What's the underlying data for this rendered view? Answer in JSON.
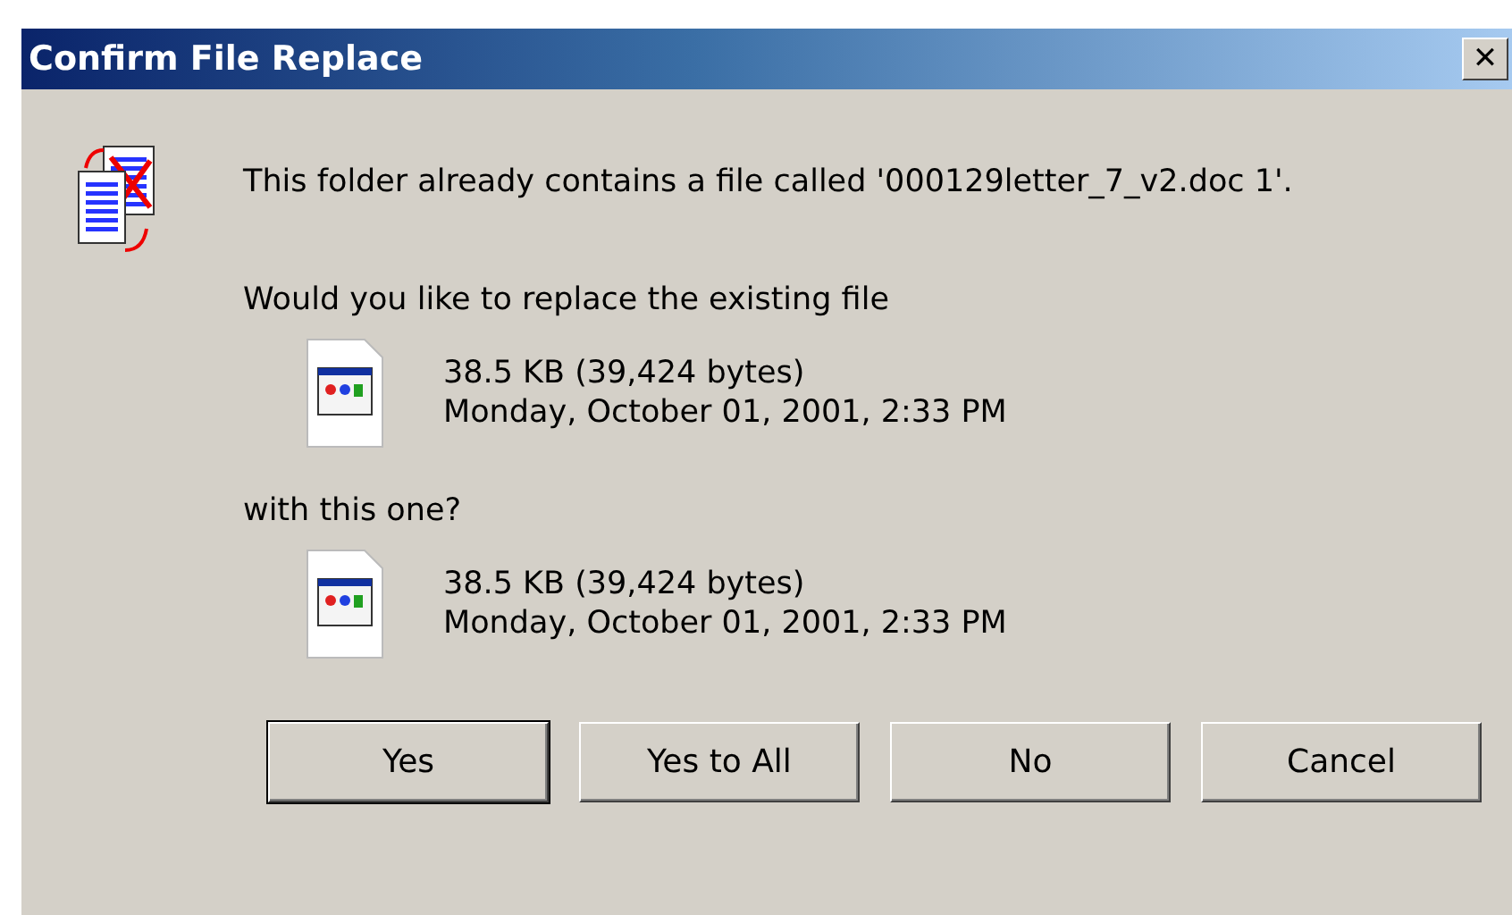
{
  "window": {
    "title": "Confirm File Replace",
    "close": "✕"
  },
  "message": "This folder already contains a file called '000129letter_7_v2.doc 1'.",
  "question": "Would you like to replace the existing file",
  "existing_file": {
    "size": "38.5 KB (39,424 bytes)",
    "modified": "Monday, October 01, 2001, 2:33 PM"
  },
  "connector": "with this one?",
  "new_file": {
    "size": "38.5 KB (39,424 bytes)",
    "modified": "Monday, October 01, 2001, 2:33 PM"
  },
  "buttons": [
    "Yes",
    "Yes to All",
    "No",
    "Cancel"
  ]
}
